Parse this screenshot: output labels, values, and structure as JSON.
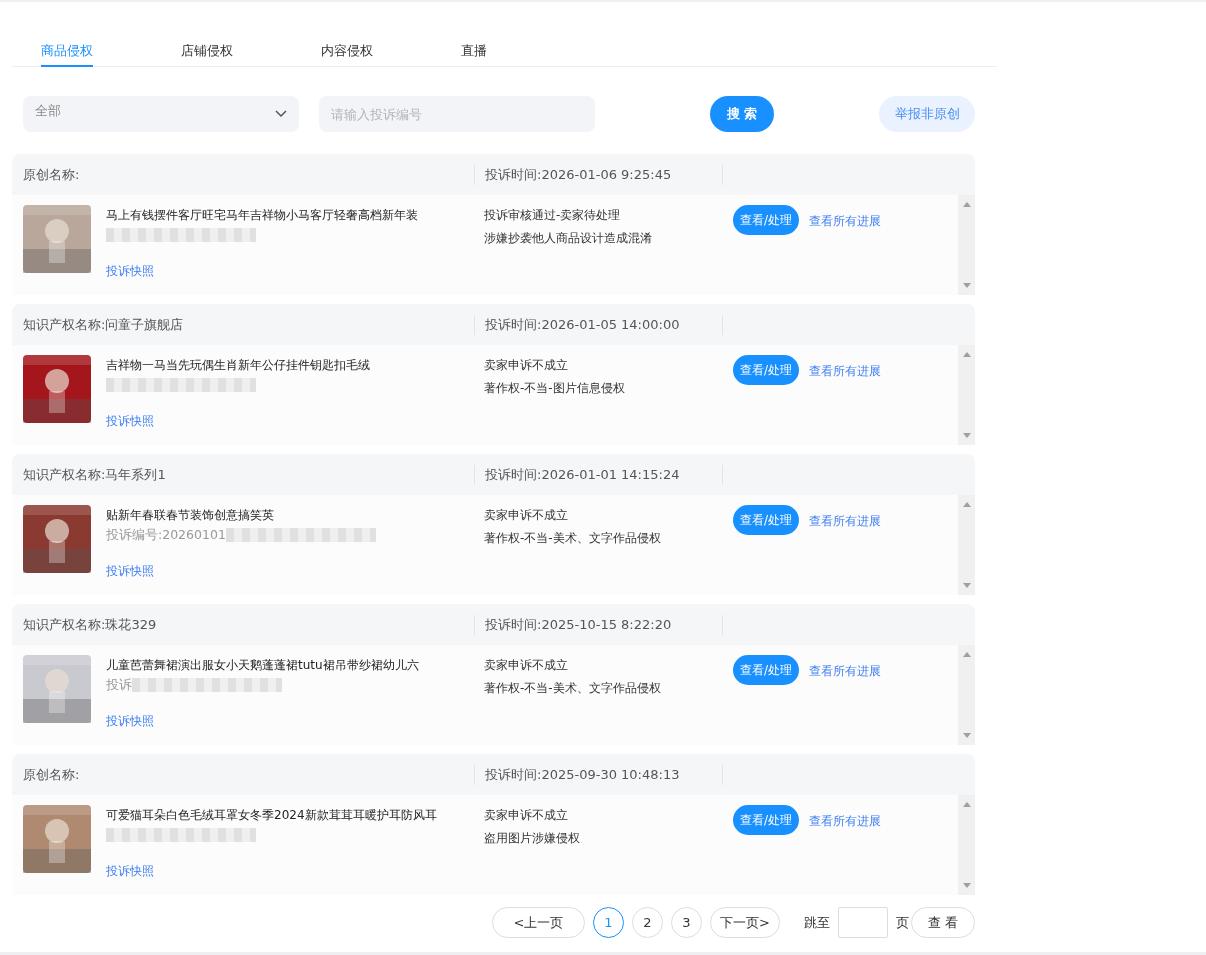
{
  "tabs": [
    {
      "label": "商品侵权",
      "selected": true
    },
    {
      "label": "店铺侵权",
      "selected": false
    },
    {
      "label": "内容侵权",
      "selected": false
    },
    {
      "label": "直播",
      "selected": false
    }
  ],
  "filters": {
    "type_select": "全部",
    "search": {
      "placeholder": "请输入投诉编号"
    },
    "search_button": "搜 索",
    "report_button": "举报非原创"
  },
  "complaints": [
    {
      "owner": "原创名称:",
      "time": "投诉时间:2026-01-06 9:25:45",
      "title": "马上有钱摆件客厅旺宅马年吉祥物小马客厅轻奢高档新年装",
      "snapshot": "投诉快照",
      "status": "投诉审核通过-卖家待处理",
      "reason": "涉嫌抄袭他人商品设计造成混淆",
      "action": "查看/处理",
      "progress": "查看所有进展"
    },
    {
      "owner": "知识产权名称:问童子旗舰店",
      "time": "投诉时间:2026-01-05 14:00:00",
      "title": "吉祥物一马当先玩偶生肖新年公仔挂件钥匙扣毛绒",
      "snapshot": "投诉快照",
      "status": "卖家申诉不成立",
      "reason": "著作权-不当-图片信息侵权",
      "action": "查看/处理",
      "progress": "查看所有进展"
    },
    {
      "owner": "知识产权名称:马年系列1",
      "time": "投诉时间:2026-01-01 14:15:24",
      "title": "贴新年春联春节装饰创意搞笑英",
      "code": "投诉编号:20260101",
      "snapshot": "投诉快照",
      "status": "卖家申诉不成立",
      "reason": "著作权-不当-美术、文字作品侵权",
      "action": "查看/处理",
      "progress": "查看所有进展"
    },
    {
      "owner": "知识产权名称:珠花329",
      "time": "投诉时间:2025-10-15 8:22:20",
      "title": "儿童芭蕾舞裙演出服女小天鹅蓬蓬裙tutu裙吊带纱裙幼儿六",
      "code": "投诉",
      "snapshot": "投诉快照",
      "status": "卖家申诉不成立",
      "reason": "著作权-不当-美术、文字作品侵权",
      "action": "查看/处理",
      "progress": "查看所有进展"
    },
    {
      "owner": "原创名称:",
      "time": "投诉时间:2025-09-30 10:48:13",
      "title": "可爱猫耳朵白色毛绒耳罩女冬季2024新款茸茸耳暖护耳防风耳",
      "snapshot": "投诉快照",
      "status": "卖家申诉不成立",
      "reason": "盗用图片涉嫌侵权",
      "action": "查看/处理",
      "progress": "查看所有进展"
    }
  ],
  "pagination": {
    "prev": "<上一页",
    "pages": [
      {
        "label": "1",
        "selected": true
      },
      {
        "label": "2",
        "selected": false
      },
      {
        "label": "3",
        "selected": false
      }
    ],
    "next": "下一页>",
    "jump_label": "跳至",
    "page_unit": "页",
    "go_button": "查 看"
  }
}
